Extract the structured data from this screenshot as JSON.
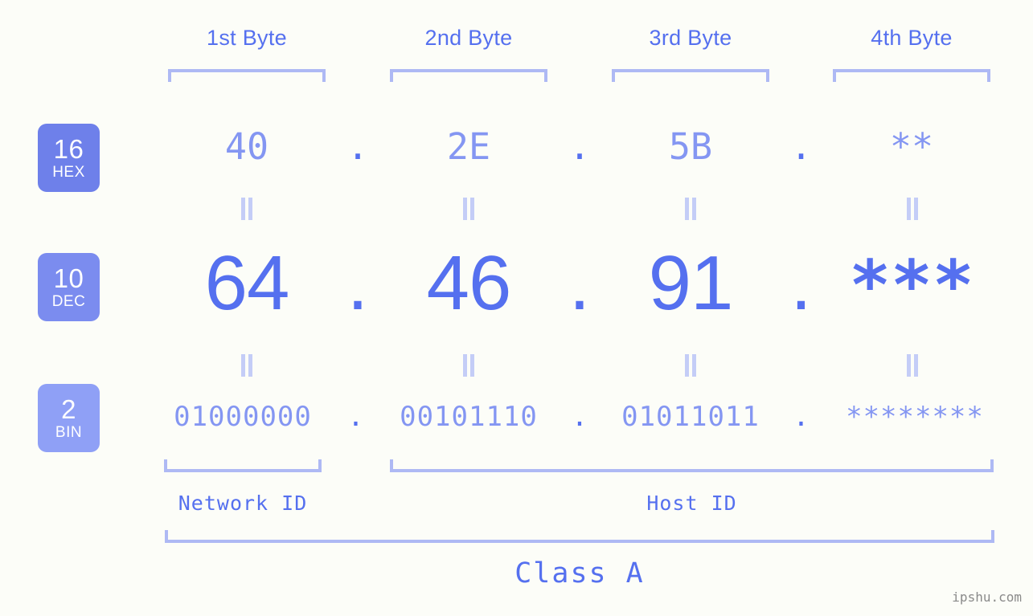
{
  "meta": {
    "background_color": "#fcfdf8",
    "accent_strong": "#5570ef",
    "accent_soft": "#8496f2",
    "accent_bracket": "#aeb9f4",
    "badge_hex_color": "#6e80ea",
    "badge_dec_color": "#7b8cef",
    "badge_bin_color": "#8fa0f6",
    "watermark": "ipshu.com"
  },
  "headers": [
    {
      "label": "1st Byte"
    },
    {
      "label": "2nd Byte"
    },
    {
      "label": "3rd Byte"
    },
    {
      "label": "4th Byte"
    }
  ],
  "bases": [
    {
      "number": "16",
      "name": "HEX"
    },
    {
      "number": "10",
      "name": "DEC"
    },
    {
      "number": "2",
      "name": "BIN"
    }
  ],
  "rows": {
    "hex": {
      "base_number": "16",
      "base_name": "HEX",
      "values": [
        "40",
        "2E",
        "5B",
        "**"
      ],
      "separator": "."
    },
    "dec": {
      "base_number": "10",
      "base_name": "DEC",
      "values": [
        "64",
        "46",
        "91",
        "***"
      ],
      "separator": "."
    },
    "bin": {
      "base_number": "2",
      "base_name": "BIN",
      "values": [
        "01000000",
        "00101110",
        "01011011",
        "********"
      ],
      "separator": "."
    }
  },
  "footer": {
    "network_id_label": "Network ID",
    "host_id_label": "Host ID",
    "class_label": "Class A"
  },
  "watermark": {
    "text": "ipshu.com"
  }
}
